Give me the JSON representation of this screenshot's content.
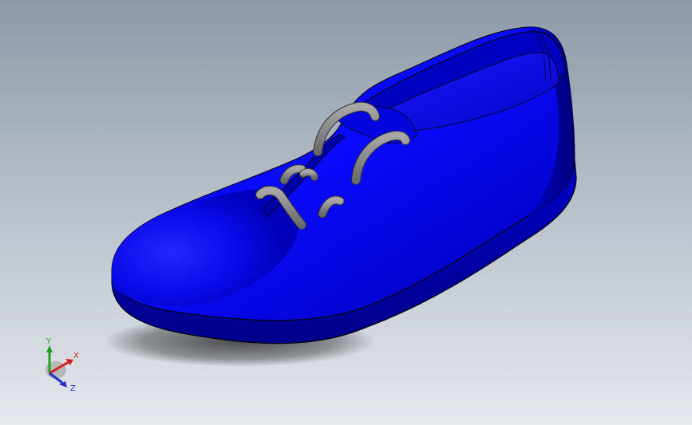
{
  "scene": {
    "model_name": "shoe-model",
    "colors": {
      "background_top": "#8d9aa8",
      "background_bottom": "#e6e9ee",
      "body": "#0a0ae6",
      "body_dark": "#020290",
      "body_light": "#2a2aff",
      "lace": "#8c8c8c",
      "edge": "#000000"
    }
  },
  "triad": {
    "x_label": "X",
    "y_label": "Y",
    "z_label": "Z",
    "colors": {
      "x": "#d42020",
      "y": "#20a020",
      "z": "#2030c8"
    }
  }
}
